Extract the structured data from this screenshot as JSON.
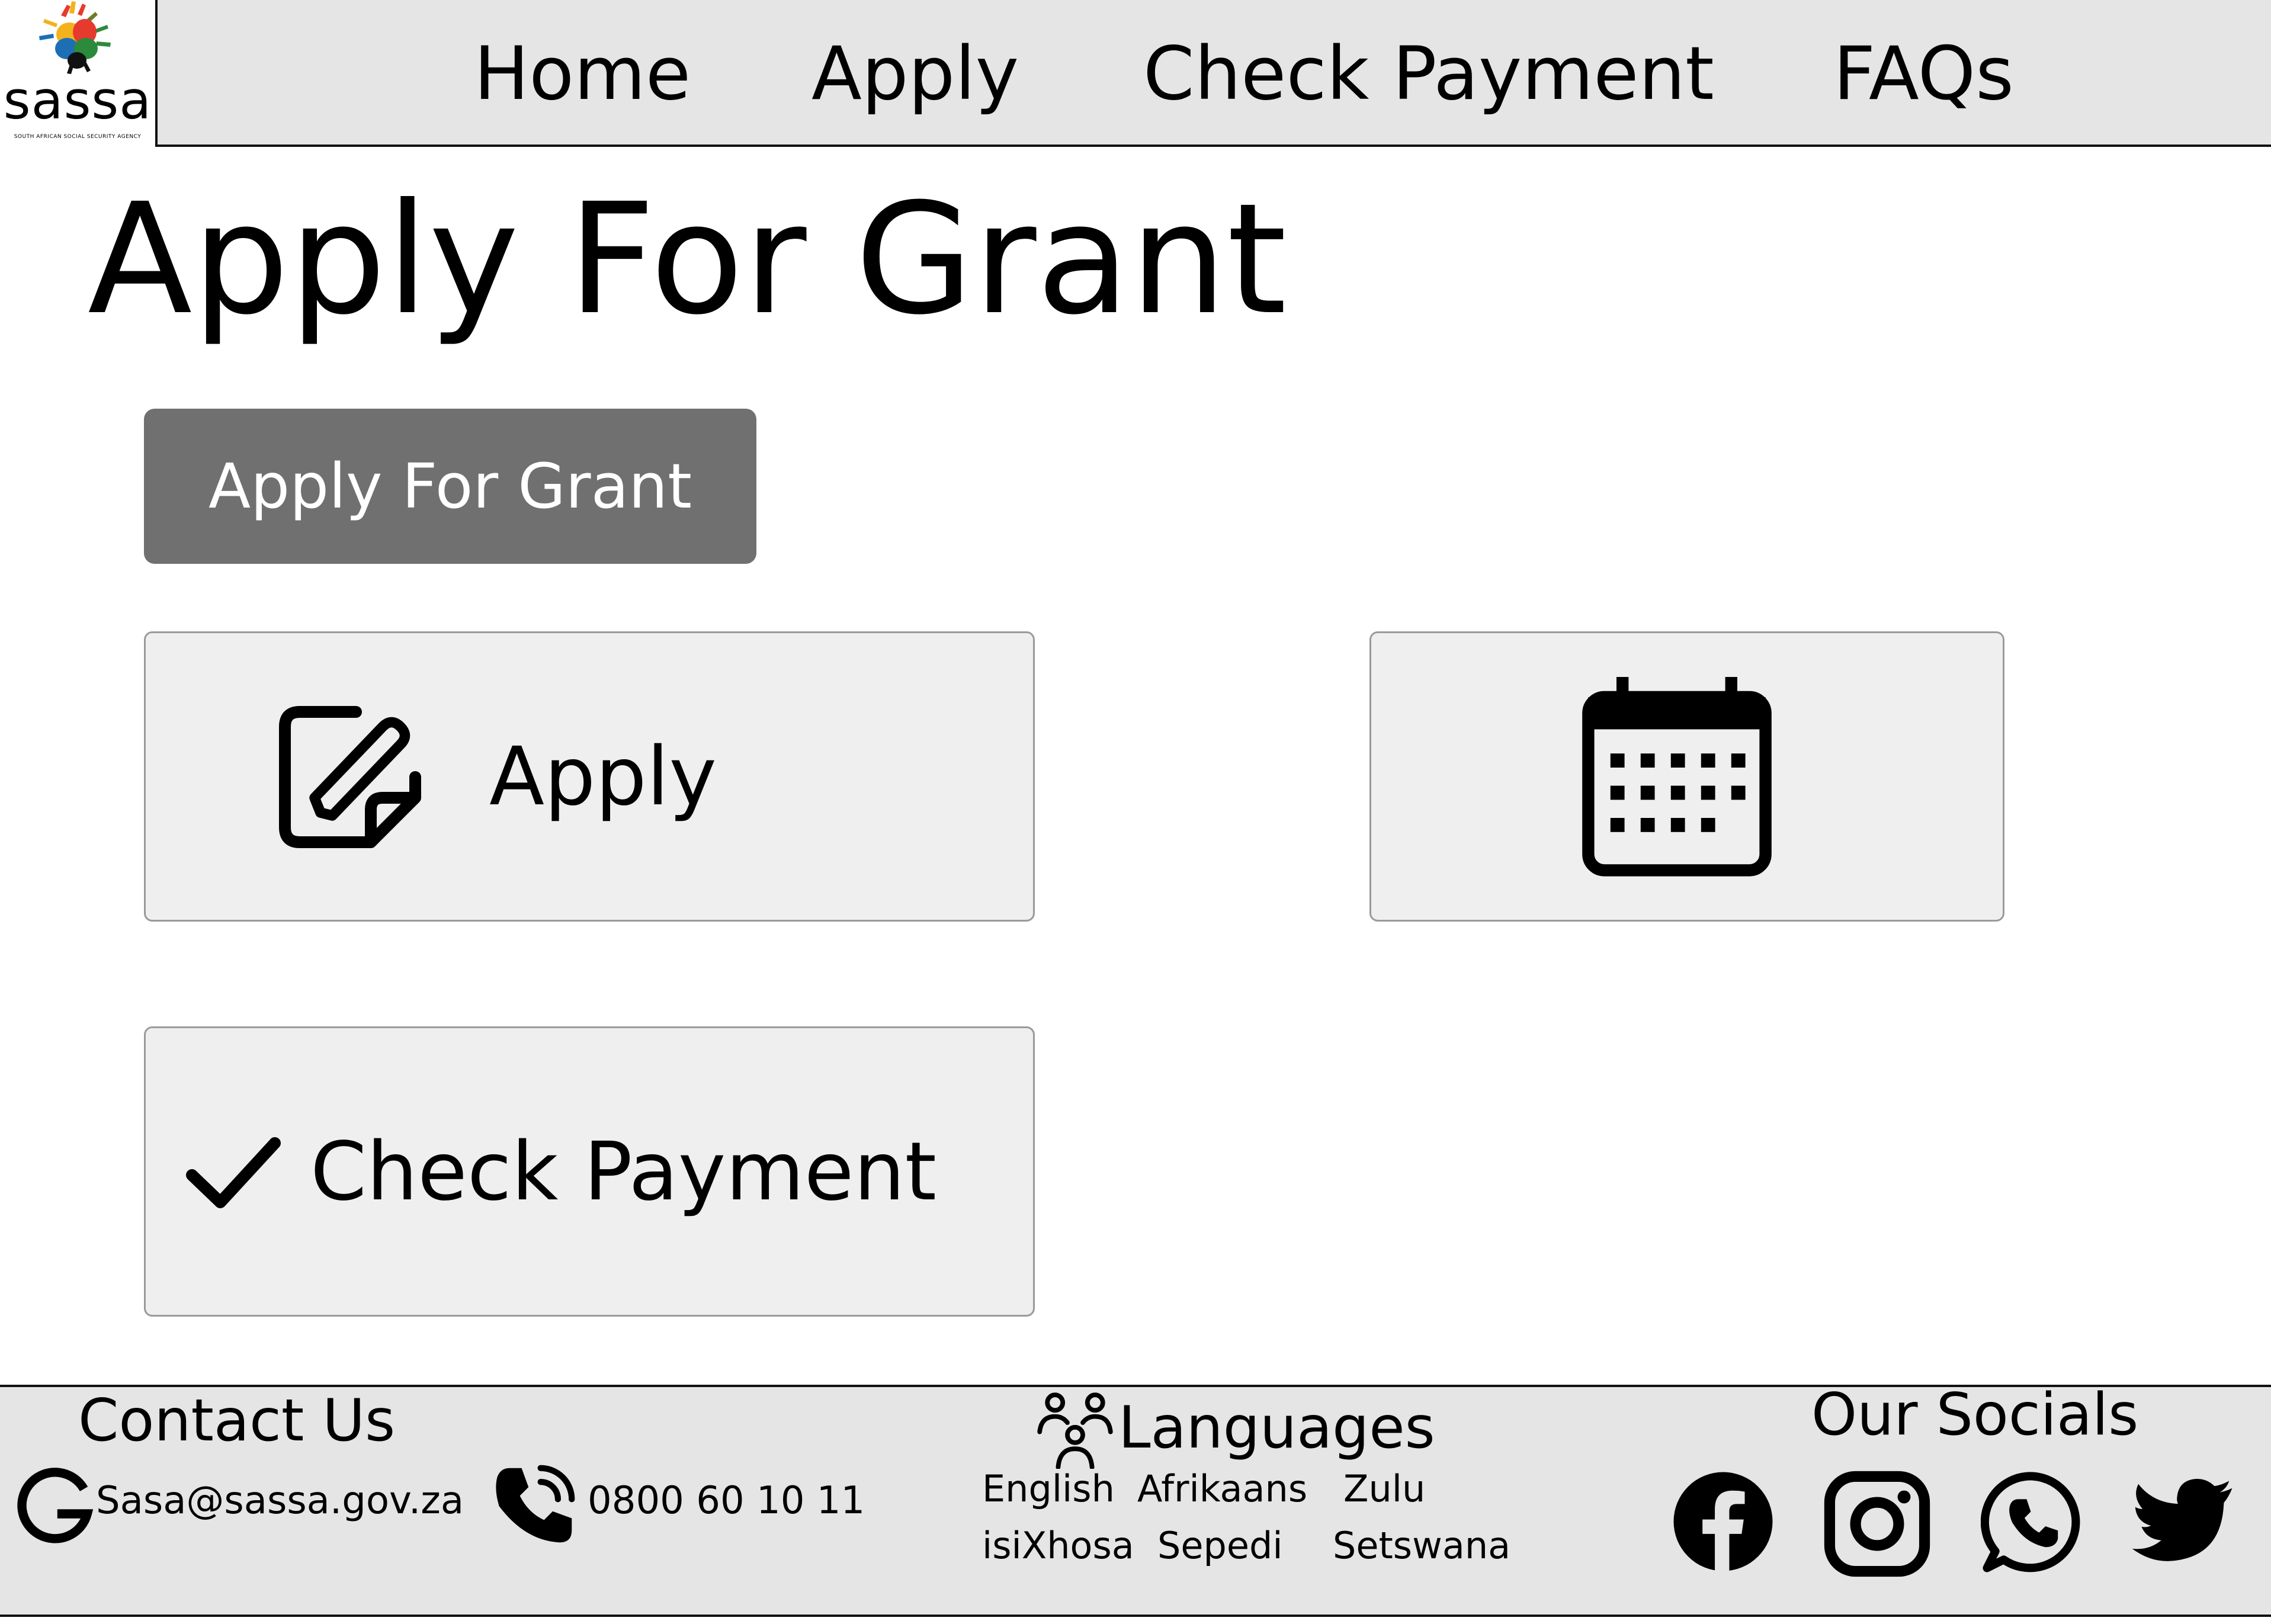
{
  "header": {
    "logo": {
      "wordmark": "sassa",
      "tagline": "SOUTH AFRICAN SOCIAL SECURITY AGENCY"
    },
    "nav": [
      {
        "label": "Home"
      },
      {
        "label": "Apply"
      },
      {
        "label": "Check Payment"
      },
      {
        "label": "FAQs"
      }
    ]
  },
  "main": {
    "title": "Apply For Grant",
    "primary_button": "Apply For Grant",
    "cards": {
      "apply": {
        "label": "Apply",
        "icon": "edit-note-icon"
      },
      "calendar": {
        "icon": "calendar-icon"
      },
      "check_payment": {
        "label": "Check Payment",
        "icon": "checkmark-icon"
      }
    }
  },
  "footer": {
    "contact": {
      "heading": "Contact Us",
      "email": "Sasa@sassa.gov.za",
      "phone": "0800 60 10 11",
      "icons": [
        "google-icon",
        "phone-icon"
      ]
    },
    "languages": {
      "heading": "Languages",
      "icon": "people-icon",
      "row1": [
        "English",
        "Afrikaans",
        "Zulu"
      ],
      "row2": [
        "isiXhosa",
        "Sepedi",
        "Setswana"
      ]
    },
    "socials": {
      "heading": "Our Socials",
      "icons": [
        "facebook-icon",
        "instagram-icon",
        "whatsapp-icon",
        "twitter-icon"
      ]
    }
  },
  "colors": {
    "header_bg": "#e5e5e5",
    "footer_bg": "#e5e5e5",
    "button_bg": "#707070",
    "card_bg": "#efefef",
    "card_border": "#9a9a9a"
  }
}
